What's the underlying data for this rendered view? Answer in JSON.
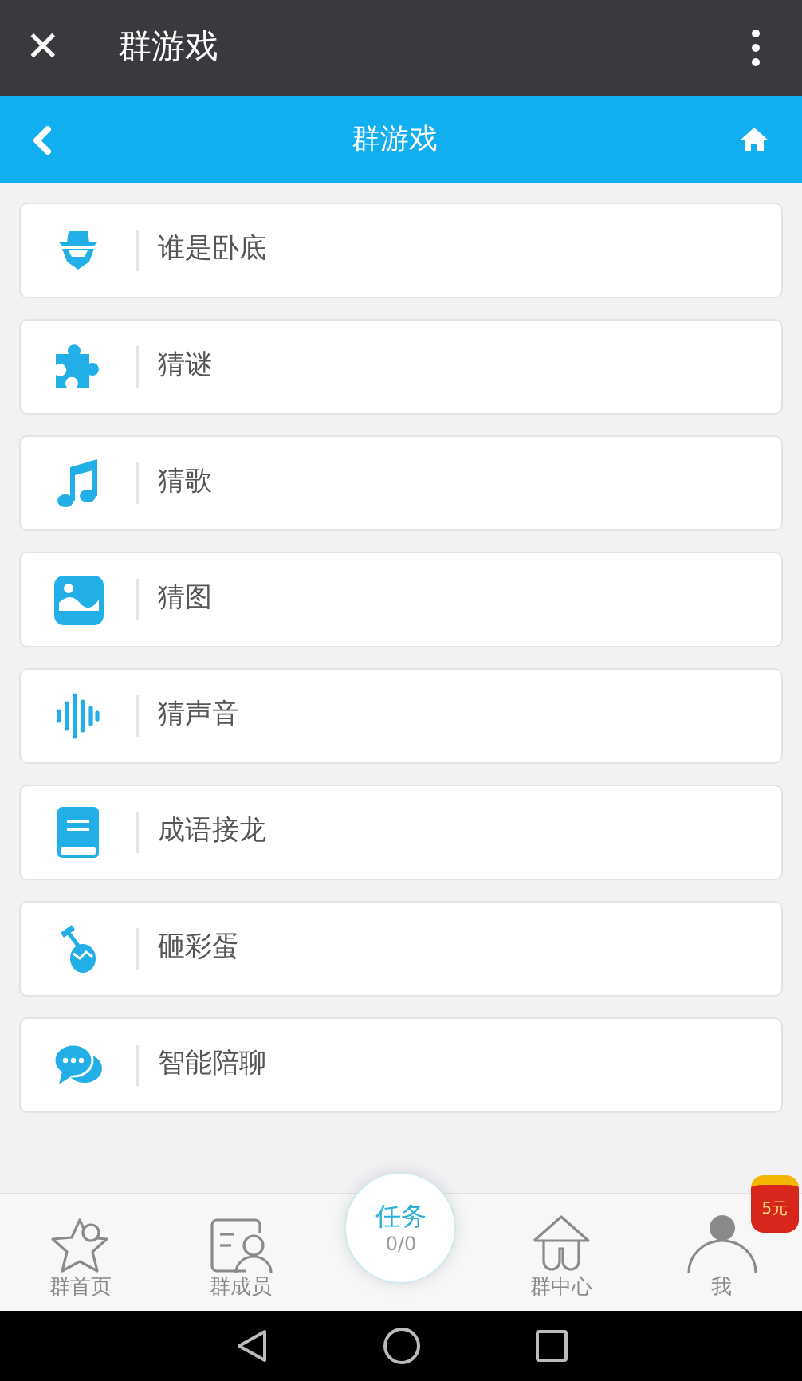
{
  "title_bar": {
    "close": "✕",
    "title": "群游戏"
  },
  "header": {
    "title": "群游戏"
  },
  "games": [
    {
      "kind": "spy",
      "label": "谁是卧底"
    },
    {
      "kind": "puzzle",
      "label": "猜谜"
    },
    {
      "kind": "music",
      "label": "猜歌"
    },
    {
      "kind": "image",
      "label": "猜图"
    },
    {
      "kind": "sound",
      "label": "猜声音"
    },
    {
      "kind": "book",
      "label": "成语接龙"
    },
    {
      "kind": "egg",
      "label": "砸彩蛋"
    },
    {
      "kind": "chat",
      "label": "智能陪聊"
    }
  ],
  "bottom_nav": [
    {
      "kind": "star",
      "label": "群首页"
    },
    {
      "kind": "members",
      "label": "群成员"
    },
    {
      "kind": "task",
      "label": "任务",
      "count": "0/0"
    },
    {
      "kind": "house",
      "label": "群中心"
    },
    {
      "kind": "me",
      "label": "我",
      "badge": "5元"
    }
  ]
}
